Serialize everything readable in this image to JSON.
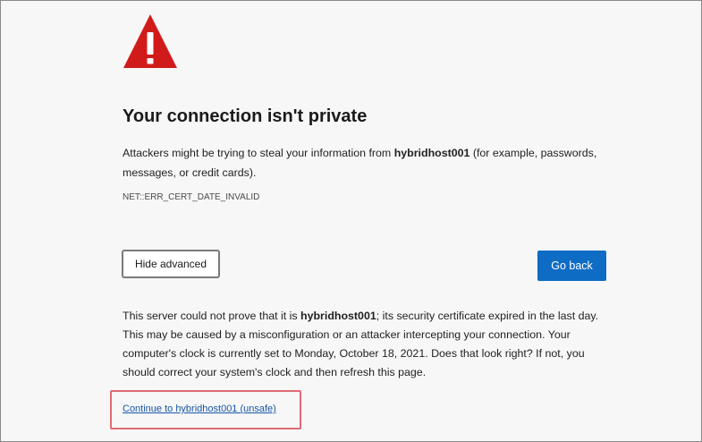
{
  "page": {
    "title": "Your connection isn't private",
    "intro_before": "Attackers might be trying to steal your information from ",
    "host": "hybridhost001",
    "intro_after": " (for example, passwords, messages, or credit cards).",
    "error_code": "NET::ERR_CERT_DATE_INVALID"
  },
  "buttons": {
    "hide_advanced": "Hide advanced",
    "go_back": "Go back"
  },
  "advanced": {
    "text_before": "This server could not prove that it is ",
    "host": "hybridhost001",
    "text_after": "; its security certificate expired in the last day. This may be caused by a misconfiguration or an attacker intercepting your connection. Your computer's clock is currently set to Monday, October 18, 2021. Does that look right? If not, you should correct your system's clock and then refresh this page.",
    "continue_link": "Continue to hybridhost001 (unsafe)"
  },
  "icons": {
    "warning": "warning-triangle-icon"
  },
  "colors": {
    "warning_red": "#d11b1b",
    "primary_button": "#0f6cc4",
    "link": "#1656a8",
    "highlight_border": "#e06a73"
  }
}
